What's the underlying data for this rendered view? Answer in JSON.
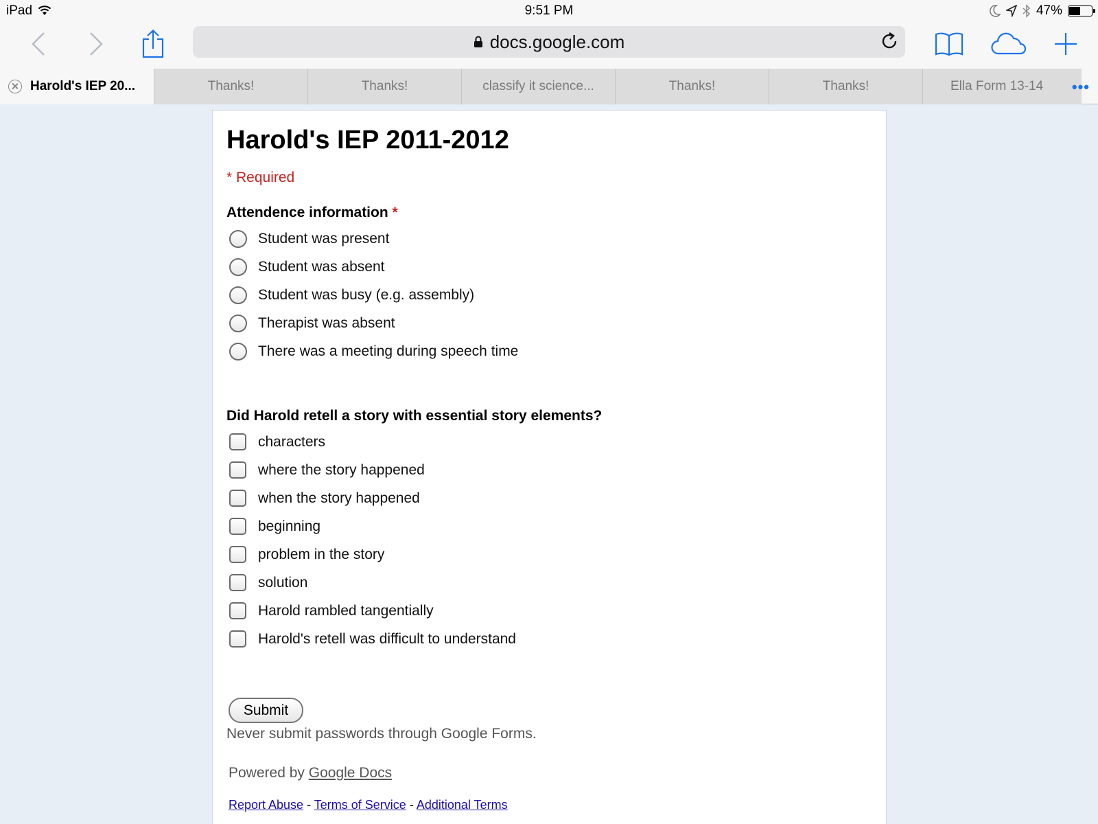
{
  "status_bar": {
    "device": "iPad",
    "time": "9:51 PM",
    "battery_percent": "47%",
    "battery_level": 0.47
  },
  "toolbar": {
    "url": "docs.google.com"
  },
  "tabs": [
    {
      "label": "Harold's IEP 20..."
    },
    {
      "label": "Thanks!"
    },
    {
      "label": "Thanks!"
    },
    {
      "label": "classify it science..."
    },
    {
      "label": "Thanks!"
    },
    {
      "label": "Thanks!"
    },
    {
      "label": "Ella Form 13-14"
    }
  ],
  "form": {
    "title": "Harold's IEP 2011-2012",
    "required_note": "* Required",
    "q1": {
      "label": "Attendence information",
      "required_mark": "*",
      "options": [
        "Student was present",
        "Student was absent",
        "Student was busy (e.g. assembly)",
        "Therapist was absent",
        "There was a meeting during speech time"
      ]
    },
    "q2": {
      "label": "Did Harold retell a story with essential story elements?",
      "options": [
        "characters",
        "where the story happened",
        "when the story happened",
        "beginning",
        "problem in the story",
        "solution",
        "Harold rambled tangentially",
        "Harold's retell was difficult to understand"
      ]
    },
    "submit_label": "Submit",
    "password_note": "Never submit passwords through Google Forms.",
    "powered_prefix": "Powered by",
    "powered_link": "Google Docs",
    "footer": {
      "report_abuse": "Report Abuse",
      "sep1": "-",
      "terms": "Terms of Service",
      "sep2": "-",
      "additional": "Additional Terms"
    }
  },
  "colors": {
    "required_red": "#c5221f",
    "safari_blue": "#1a73e8",
    "page_bg": "#e8eef6"
  }
}
